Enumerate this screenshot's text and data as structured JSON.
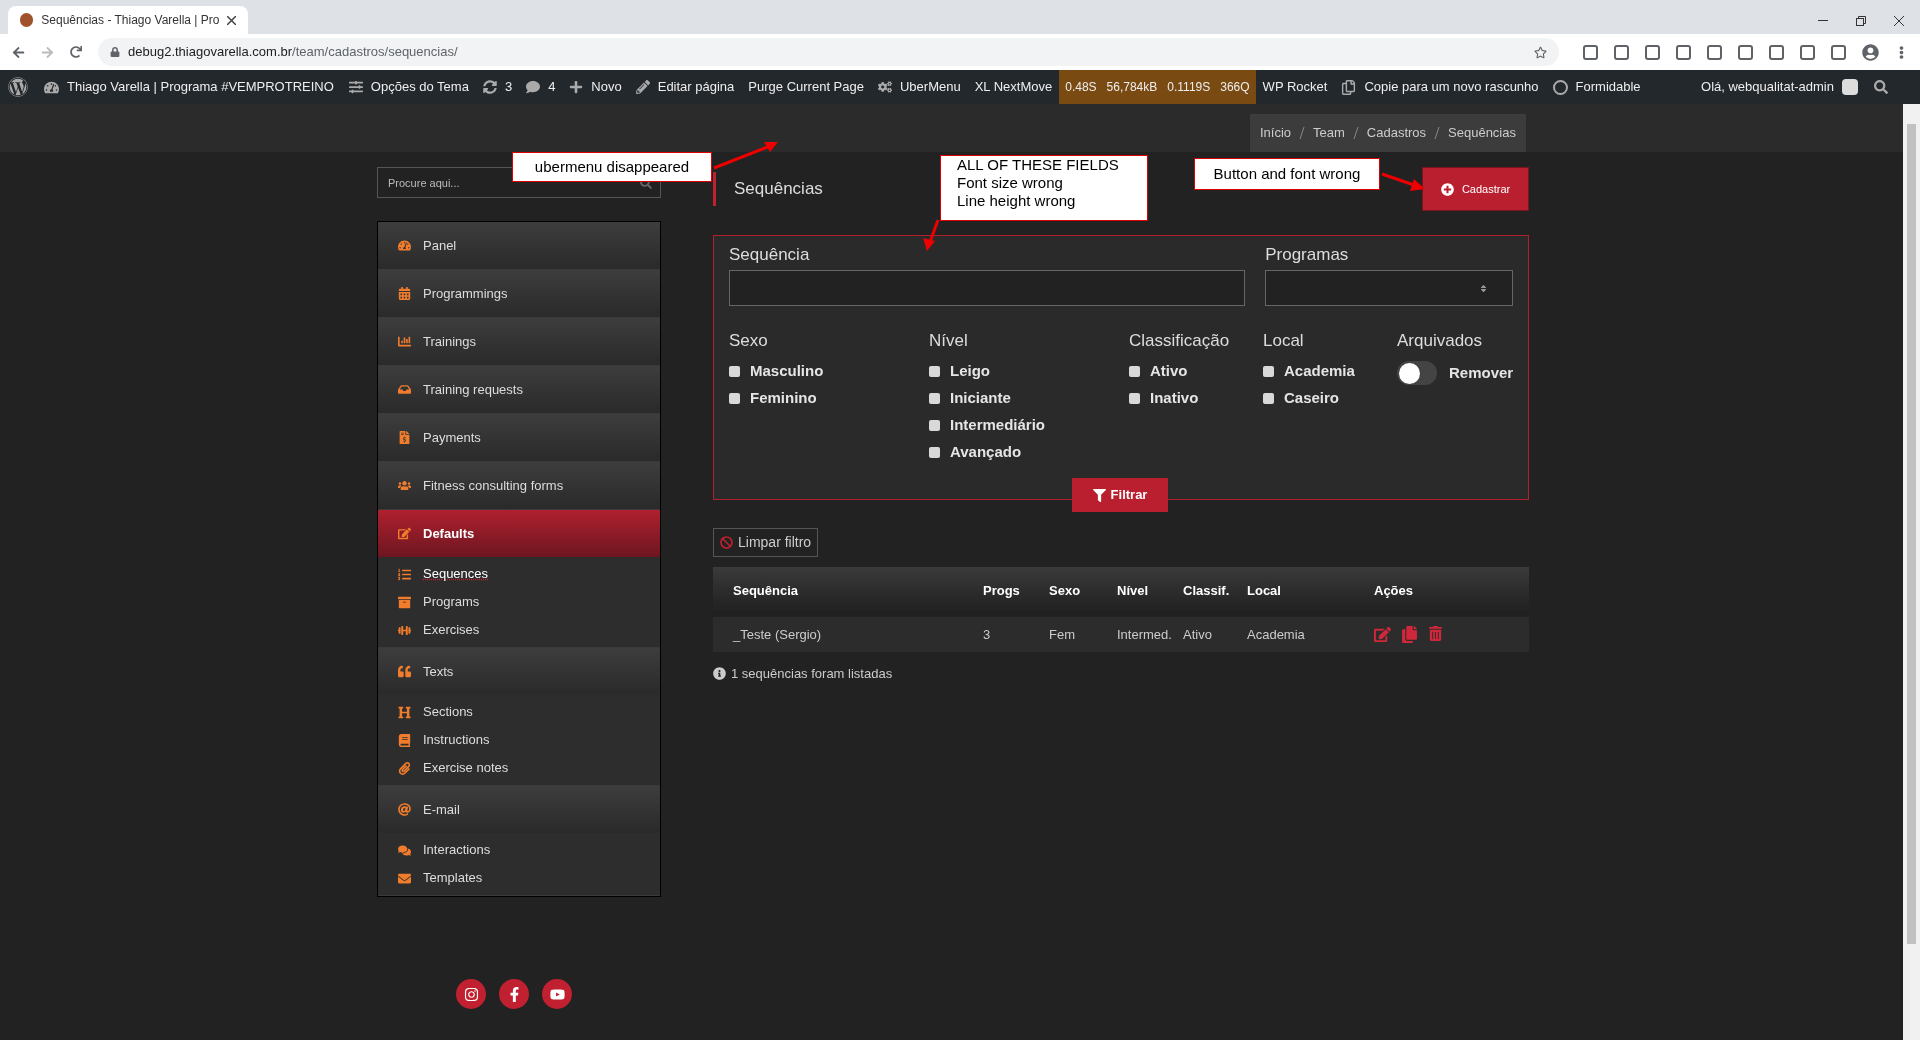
{
  "browser": {
    "tab_title": "Sequências - Thiago Varella | Pro",
    "url_host": "debug2.thiagovarella.com.br",
    "url_path": "/team/cadastros/sequencias/"
  },
  "admin_bar": {
    "site": "Thiago Varella | Programa #VEMPROTREINO",
    "items": [
      "Opções do Tema",
      "3",
      "4",
      "Novo",
      "Editar página",
      "Purge Current Page",
      "UberMenu",
      "XL NextMove"
    ],
    "metrics": [
      "0.48S",
      "56,784kB",
      "0.1119S",
      "366Q"
    ],
    "items_after": [
      "WP Rocket",
      "Copie para um novo rascunho",
      "Formidable"
    ],
    "greeting": "Olá, webqualitat-admin"
  },
  "breadcrumb": [
    "Início",
    "Team",
    "Cadastros",
    "Sequências"
  ],
  "search": {
    "placeholder": "Procure aqui..."
  },
  "sidebar": [
    {
      "label": "Panel",
      "selected": false
    },
    {
      "label": "Programmings",
      "selected": false
    },
    {
      "label": "Trainings",
      "selected": false
    },
    {
      "label": "Training requests",
      "selected": false
    },
    {
      "label": "Payments",
      "selected": false
    },
    {
      "label": "Fitness consulting forms",
      "selected": false
    },
    {
      "label": "Defaults",
      "selected": true,
      "children": [
        {
          "label": "Sequences",
          "selected": true
        },
        {
          "label": "Programs",
          "selected": false
        },
        {
          "label": "Exercises",
          "selected": false
        }
      ]
    },
    {
      "label": "Texts",
      "selected": false,
      "children": [
        {
          "label": "Sections",
          "selected": false
        },
        {
          "label": "Instructions",
          "selected": false
        },
        {
          "label": "Exercise notes",
          "selected": false
        }
      ]
    },
    {
      "label": "E-mail",
      "selected": false,
      "children": [
        {
          "label": "Interactions",
          "selected": false
        },
        {
          "label": "Templates",
          "selected": false
        }
      ]
    }
  ],
  "page_title": "Sequências",
  "new_button": "Cadastrar",
  "filter": {
    "text_field": {
      "label": "Sequência"
    },
    "select_field": {
      "label": "Programas"
    },
    "groups": [
      {
        "label": "Sexo",
        "options": [
          {
            "label": "Masculino",
            "checked": false
          },
          {
            "label": "Feminino",
            "checked": false
          }
        ]
      },
      {
        "label": "Nível",
        "options": [
          {
            "label": "Leigo",
            "checked": false
          },
          {
            "label": "Iniciante",
            "checked": false
          },
          {
            "label": "Intermediário",
            "checked": false
          },
          {
            "label": "Avançado",
            "checked": false
          }
        ]
      },
      {
        "label": "Classificação",
        "options": [
          {
            "label": "Ativo",
            "checked": false
          },
          {
            "label": "Inativo",
            "checked": false
          }
        ]
      },
      {
        "label": "Local",
        "options": [
          {
            "label": "Academia",
            "checked": false
          },
          {
            "label": "Caseiro",
            "checked": false
          }
        ]
      }
    ],
    "toggle": {
      "heading": "Arquivados",
      "label": "Remover",
      "on": false
    },
    "submit": "Filtrar"
  },
  "clear_button": "Limpar filtro",
  "table": {
    "columns": [
      "Sequência",
      "Progs",
      "Sexo",
      "Nível",
      "Classif.",
      "Local",
      "Ações"
    ],
    "rows": [
      [
        "_Teste (Sergio)",
        "3",
        "Fem",
        "Intermed.",
        "Ativo",
        "Academia"
      ]
    ]
  },
  "result_note": "1 sequências foram listadas",
  "annotations": [
    {
      "lines": [
        "ubermenu disappeared"
      ]
    },
    {
      "lines": [
        "ALL OF THESE FIELDS",
        "Font size wrong",
        "Line height wrong"
      ]
    },
    {
      "lines": [
        "Button and font wrong"
      ]
    }
  ]
}
